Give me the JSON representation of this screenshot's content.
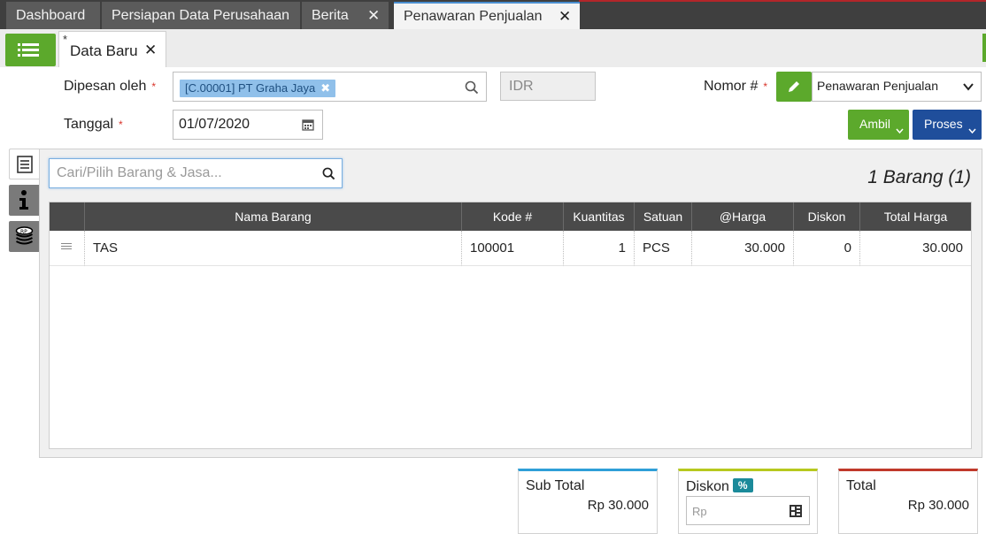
{
  "top_tabs": [
    {
      "label": "Dashboard"
    },
    {
      "label": "Persiapan Data Perusahaan"
    },
    {
      "label": "Berita"
    },
    {
      "label": "Penawaran Penjualan"
    }
  ],
  "sub_tab": {
    "modified_mark": "*",
    "label": "Data Baru"
  },
  "form": {
    "dipesan_label": "Dipesan oleh",
    "required_mark": "*",
    "customer_chip": "[C.00001] PT Graha Jaya",
    "currency": "IDR",
    "tanggal_label": "Tanggal",
    "tanggal_value": "01/07/2020",
    "nomor_label": "Nomor #",
    "nomor_type": "Penawaran Penjualan"
  },
  "buttons": {
    "ambil": "Ambil",
    "proses": "Proses"
  },
  "items": {
    "search_placeholder": "Cari/Pilih Barang & Jasa...",
    "count_text": "1 Barang (1)",
    "columns": [
      "Nama Barang",
      "Kode #",
      "Kuantitas",
      "Satuan",
      "@Harga",
      "Diskon",
      "Total Harga"
    ],
    "rows": [
      {
        "nama": "TAS",
        "kode": "100001",
        "kuantitas": "1",
        "satuan": "PCS",
        "harga": "30.000",
        "diskon": "0",
        "total": "30.000"
      }
    ]
  },
  "totals": {
    "sub_total_label": "Sub Total",
    "sub_total_value": "Rp 30.000",
    "diskon_label": "Diskon",
    "diskon_badge": "%",
    "diskon_placeholder": "Rp",
    "total_label": "Total",
    "total_value": "Rp 30.000"
  },
  "colors": {
    "accent_green": "#5ca92c",
    "accent_blue": "#1f4e9b",
    "header_dark": "#4a4a4a",
    "subtotal_bar": "#2f9fd8",
    "diskon_bar": "#b7c91f",
    "total_bar": "#c0392b"
  }
}
